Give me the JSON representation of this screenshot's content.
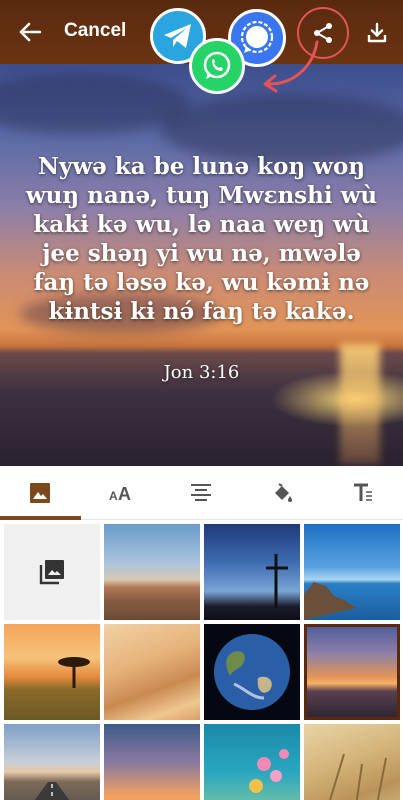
{
  "header": {
    "cancel_label": "Cancel",
    "share_apps": [
      "telegram-icon",
      "signal-icon",
      "whatsapp-icon"
    ]
  },
  "verse": {
    "text": "Nywə ka be lunə koŋ woŋ wuŋ nanə, tuŋ Mwɛnshi wù kakɨ kə wu, lə naa weŋ wù jee shəŋ yi wu nə, mwələ faŋ tə ləsə kə, wu kəmɨ nə kɨntsɨ kɨ nə́ faŋ tə kakə.",
    "reference": "Jon 3:16"
  },
  "toolbar": {
    "tools": [
      "image-icon",
      "font-size-icon",
      "align-icon",
      "fill-color-icon",
      "text-format-icon"
    ],
    "active": "image-icon"
  },
  "backgrounds": {
    "items": [
      "gallery",
      "desert-mountains",
      "cross-silhouette",
      "rocky-coast",
      "savanna-tree",
      "sand-dunes",
      "earth-globe",
      "sunset-sea",
      "road-sunset",
      "sky-gradient",
      "pink-flowers",
      "wheat-field"
    ],
    "selected": "sunset-sea"
  },
  "colors": {
    "header": "#5a2a0e",
    "accent": "#7a4a1c",
    "share_ring": "#e35357",
    "telegram": "#2ba5df",
    "signal": "#3a76f0",
    "whatsapp": "#25d366"
  }
}
